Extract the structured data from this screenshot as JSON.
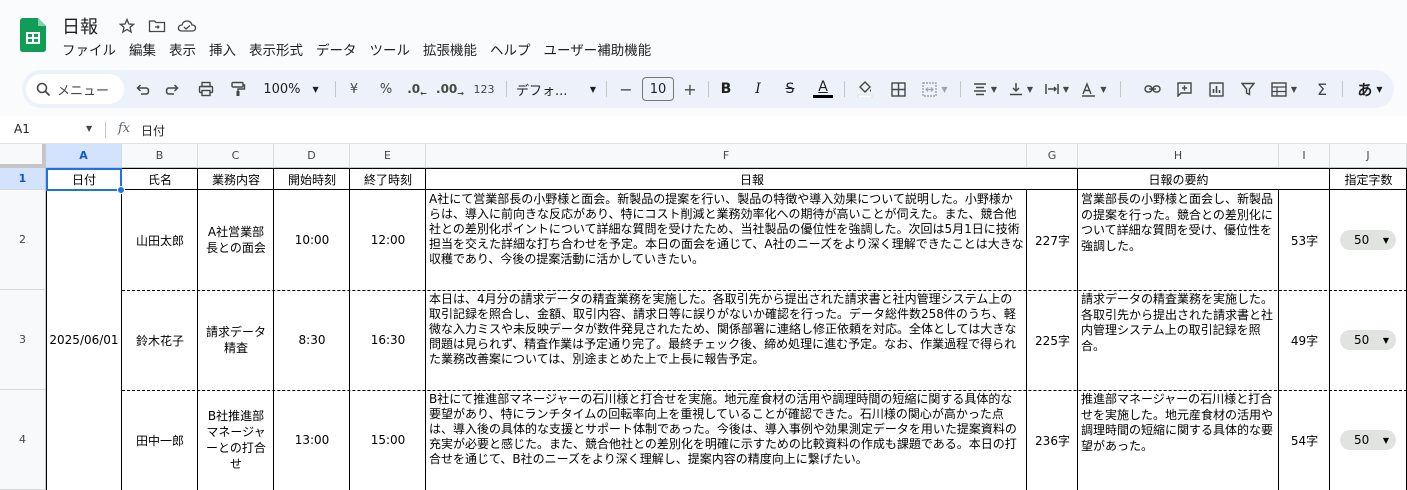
{
  "app": {
    "title": "日報",
    "menu": [
      "ファイル",
      "編集",
      "表示",
      "挿入",
      "表示形式",
      "データ",
      "ツール",
      "拡張機能",
      "ヘルプ",
      "ユーザー補助機能"
    ]
  },
  "toolbar": {
    "search_label": "メニュー",
    "zoom": "100%",
    "currency": "¥",
    "percent": "%",
    "dec_decrease": ".0",
    "dec_increase": ".00",
    "number_format": "123",
    "font": "デフォ...",
    "font_size": "10",
    "minus": "−",
    "plus": "+",
    "bold": "B",
    "italic": "I",
    "strike": "S",
    "text_color": "A",
    "sigma": "Σ",
    "ime": "あ"
  },
  "formula_bar": {
    "cell_ref": "A1",
    "fx": "fx",
    "content": "日付"
  },
  "grid": {
    "columns": [
      "A",
      "B",
      "C",
      "D",
      "E",
      "F",
      "G",
      "H",
      "I",
      "J"
    ],
    "rows": [
      "1",
      "2",
      "3",
      "4"
    ],
    "header_row": [
      "日付",
      "氏名",
      "業務内容",
      "開始時刻",
      "終了時刻",
      "日報",
      "",
      "日報の要約",
      "",
      "指定字数"
    ],
    "date": "2025/06/01",
    "records": [
      {
        "name": "山田太郎",
        "task": "A社営業部長との面会",
        "start": "10:00",
        "end": "12:00",
        "report": "A社にて営業部長の小野様と面会。新製品の提案を行い、製品の特徴や導入効果について説明した。小野様からは、導入に前向きな反応があり、特にコスト削減と業務効率化への期待が高いことが伺えた。また、競合他社との差別化ポイントについて詳細な質問を受けたため、当社製品の優位性を強調した。次回は5月1日に技術担当を交えた詳細な打ち合わせを予定。本日の面会を通じて、A社のニーズをより深く理解できたことは大きな収穫であり、今後の提案活動に活かしていきたい。",
        "report_len": "227字",
        "summary": "営業部長の小野様と面会し、新製品の提案を行った。競合との差別化について詳細な質問を受け、優位性を強調した。",
        "summary_len": "53字",
        "limit": "50"
      },
      {
        "name": "鈴木花子",
        "task": "請求データ精査",
        "start": "8:30",
        "end": "16:30",
        "report": "本日は、4月分の請求データの精査業務を実施した。各取引先から提出された請求書と社内管理システム上の取引記録を照合し、金額、取引内容、請求日等に誤りがないか確認を行った。データ総件数258件のうち、軽微な入力ミスや未反映データが数件発見されたため、関係部署に連絡し修正依頼を対応。全体としては大きな問題は見られず、精査作業は予定通り完了。最終チェック後、締め処理に進む予定。なお、作業過程で得られた業務改善案については、別途まとめた上で上長に報告予定。",
        "report_len": "225字",
        "summary": "請求データの精査業務を実施した。各取引先から提出された請求書と社内管理システム上の取引記録を照合。",
        "summary_len": "49字",
        "limit": "50"
      },
      {
        "name": "田中一郎",
        "task": "B社推進部マネージャーとの打合せ",
        "start": "13:00",
        "end": "15:00",
        "report": "B社にて推進部マネージャーの石川様と打合せを実施。地元産食材の活用や調理時間の短縮に関する具体的な要望があり、特にランチタイムの回転率向上を重視していることが確認できた。石川様の関心が高かった点は、導入後の具体的な支援とサポート体制であった。今後は、導入事例や効果測定データを用いた提案資料の充実が必要と感じた。また、競合他社との差別化を明確に示すための比較資料の作成も課題である。本日の打合せを通じて、B社のニーズをより深く理解し、提案内容の精度向上に繋げたい。",
        "report_len": "236字",
        "summary": "推進部マネージャーの石川様と打合せを実施した。地元産食材の活用や調理時間の短縮に関する具体的な要望があった。",
        "summary_len": "54字",
        "limit": "50"
      }
    ]
  },
  "colors": {
    "accent": "#0b57d0",
    "selection": "#1a73e8",
    "sheets_green": "#0f9d58",
    "toolbar_bg": "#edf2fa"
  }
}
